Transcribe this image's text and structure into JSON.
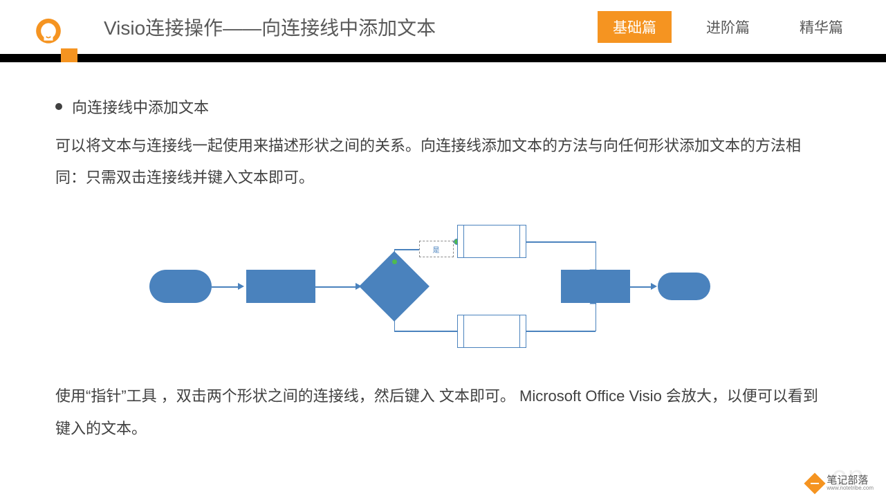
{
  "header": {
    "title": "Visio连接操作——向连接线中添加文本",
    "tabs": [
      {
        "label": "基础篇",
        "active": true
      },
      {
        "label": "进阶篇",
        "active": false
      },
      {
        "label": "精华篇",
        "active": false
      }
    ]
  },
  "content": {
    "bullet_title": "向连接线中添加文本",
    "paragraph1": "可以将文本与连接线一起使用来描述形状之间的关系。向连接线添加文本的方法与向任何形状添加文本的方法相同：只需双击连接线并键入文本即可。",
    "paragraph2": "使用“指针”工具 ，双击两个形状之间的连接线，然后键入 文本即可。 Microsoft Office Visio 会放大，以便可以看到键入的文本。",
    "textbox_label": "是"
  },
  "diagram": {
    "shapes": [
      {
        "type": "terminator",
        "role": "start"
      },
      {
        "type": "process"
      },
      {
        "type": "decision"
      },
      {
        "type": "subprocess",
        "position": "top"
      },
      {
        "type": "subprocess",
        "position": "bottom"
      },
      {
        "type": "process"
      },
      {
        "type": "terminator",
        "role": "end"
      }
    ]
  },
  "watermark": {
    "main": "笔记部落",
    "sub": "www.notetribe.com",
    "bg": "cn"
  }
}
